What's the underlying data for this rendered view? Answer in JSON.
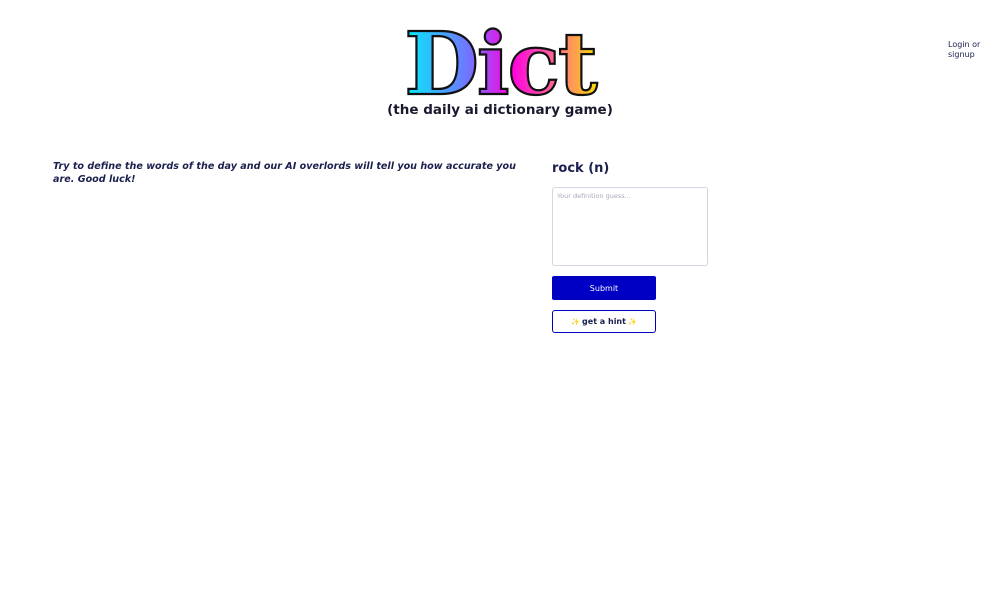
{
  "header": {
    "logo_text": "Dict",
    "subtitle": "(the daily ai dictionary game)",
    "login_label": "Login or signup"
  },
  "intro": {
    "text": "Try to define the words of the day and our AI overlords will tell you how accurate you are. Good luck!"
  },
  "game": {
    "word": "rock (n)",
    "guess_value": "",
    "guess_placeholder": "Your definition guess...",
    "submit_label": "Submit",
    "hint_label": "get a hint",
    "hint_icon": "sparkle-icon"
  },
  "colors": {
    "primary": "#0000c4",
    "text": "#1a1f4e",
    "logo_gradient": [
      "#00f0ff",
      "#ff00e0",
      "#ffe000"
    ]
  }
}
